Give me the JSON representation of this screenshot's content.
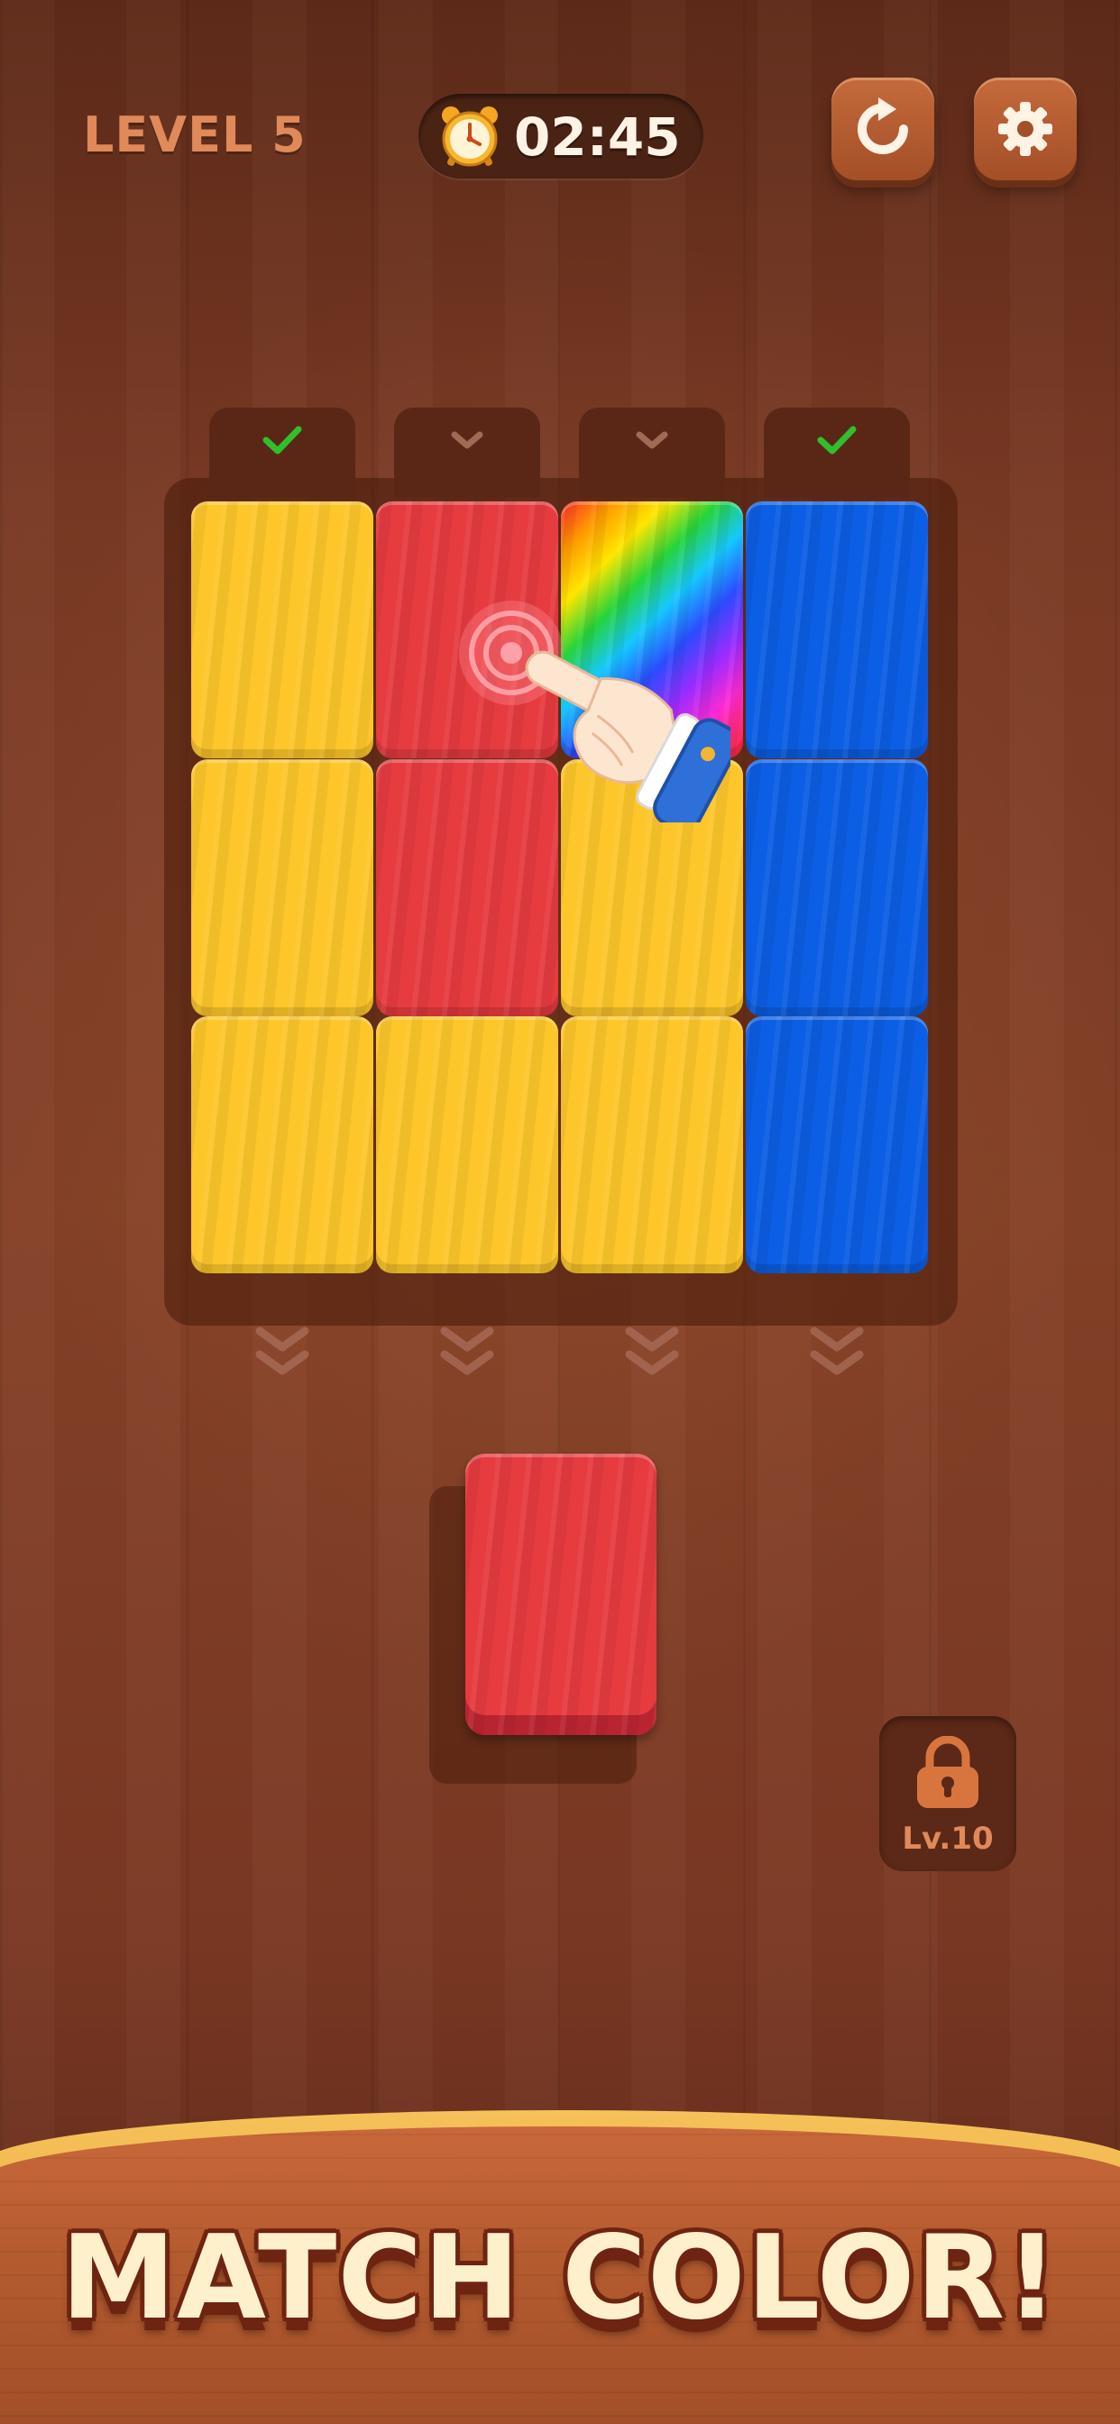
{
  "header": {
    "level_label": "LEVEL 5",
    "timer_text": "02:45",
    "restart_icon": "restart-icon",
    "settings_icon": "gear-icon"
  },
  "board": {
    "columns": [
      {
        "status": "complete",
        "tiles": [
          "yellow",
          "yellow",
          "yellow"
        ]
      },
      {
        "status": "pending",
        "tiles": [
          "red",
          "red",
          "yellow"
        ]
      },
      {
        "status": "pending",
        "tiles": [
          "rainbow",
          "yellow",
          "yellow"
        ]
      },
      {
        "status": "complete",
        "tiles": [
          "blue",
          "blue",
          "blue"
        ]
      }
    ],
    "colors": {
      "yellow": "#fdc62a",
      "red": "#e63b3f",
      "blue": "#0c5ee4",
      "check": "#2fbf2f",
      "chevron": "#a06a55"
    }
  },
  "loose_block": {
    "color": "red"
  },
  "locked_slot": {
    "label": "Lv.10",
    "icon": "lock-icon"
  },
  "tutorial": {
    "icon": "pointing-hand-icon"
  },
  "banner": {
    "text": "MATCH COLOR!"
  }
}
